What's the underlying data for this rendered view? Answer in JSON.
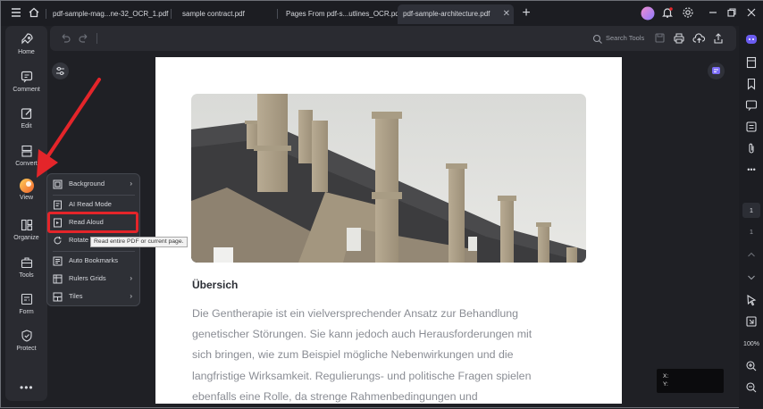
{
  "tabs": [
    {
      "label": "pdf-sample-mag...ne-32_OCR_1.pdf"
    },
    {
      "label": "sample contract.pdf"
    },
    {
      "label": "Pages From pdf-s...utlines_OCR.pdf"
    },
    {
      "label": "pdf-sample-architecture.pdf"
    }
  ],
  "toolbar": {
    "search_label": "Search Tools"
  },
  "left_rail": [
    {
      "label": "Home",
      "icon": "rocket-icon"
    },
    {
      "label": "Comment",
      "icon": "comment-icon"
    },
    {
      "label": "Edit",
      "icon": "edit-icon"
    },
    {
      "label": "Convert",
      "icon": "convert-icon"
    },
    {
      "label": "View",
      "icon": "view-icon"
    },
    {
      "label": "Organize",
      "icon": "organize-icon"
    },
    {
      "label": "Tools",
      "icon": "tools-icon"
    },
    {
      "label": "Form",
      "icon": "form-icon"
    },
    {
      "label": "Protect",
      "icon": "protect-icon"
    }
  ],
  "view_menu": {
    "items": [
      {
        "label": "Background",
        "submenu": true
      },
      {
        "label": "AI Read Mode",
        "submenu": false
      },
      {
        "label": "Read Aloud",
        "submenu": false
      },
      {
        "label": "Rotate",
        "submenu": false
      },
      {
        "label": "Auto Bookmarks",
        "submenu": false
      },
      {
        "label": "Rulers  Grids",
        "submenu": true
      },
      {
        "label": "Tiles",
        "submenu": true
      }
    ],
    "tooltip": "Read entire PDF or current page."
  },
  "document": {
    "heading": "Übersich",
    "paragraph_lines": [
      "Die Gentherapie ist ein vielversprechender Ansatz zur Behandlung",
      "genetischer Störungen. Sie kann jedoch auch Herausforderungen mit",
      "sich bringen, wie zum Beispiel mögliche Nebenwirkungen und die",
      "langfristige Wirksamkeit. Regulierungs- und politische Fragen spielen",
      "ebenfalls eine Rolle, da strenge Rahmenbedingungen und"
    ]
  },
  "right_rail": {
    "page_number": "1",
    "zoom": "100%"
  },
  "coords": {
    "x_label": "X:",
    "y_label": "Y:"
  },
  "colors": {
    "accent_red": "#e4252a",
    "rail_bg": "#2a2b31",
    "app_bg": "#1f2025"
  }
}
